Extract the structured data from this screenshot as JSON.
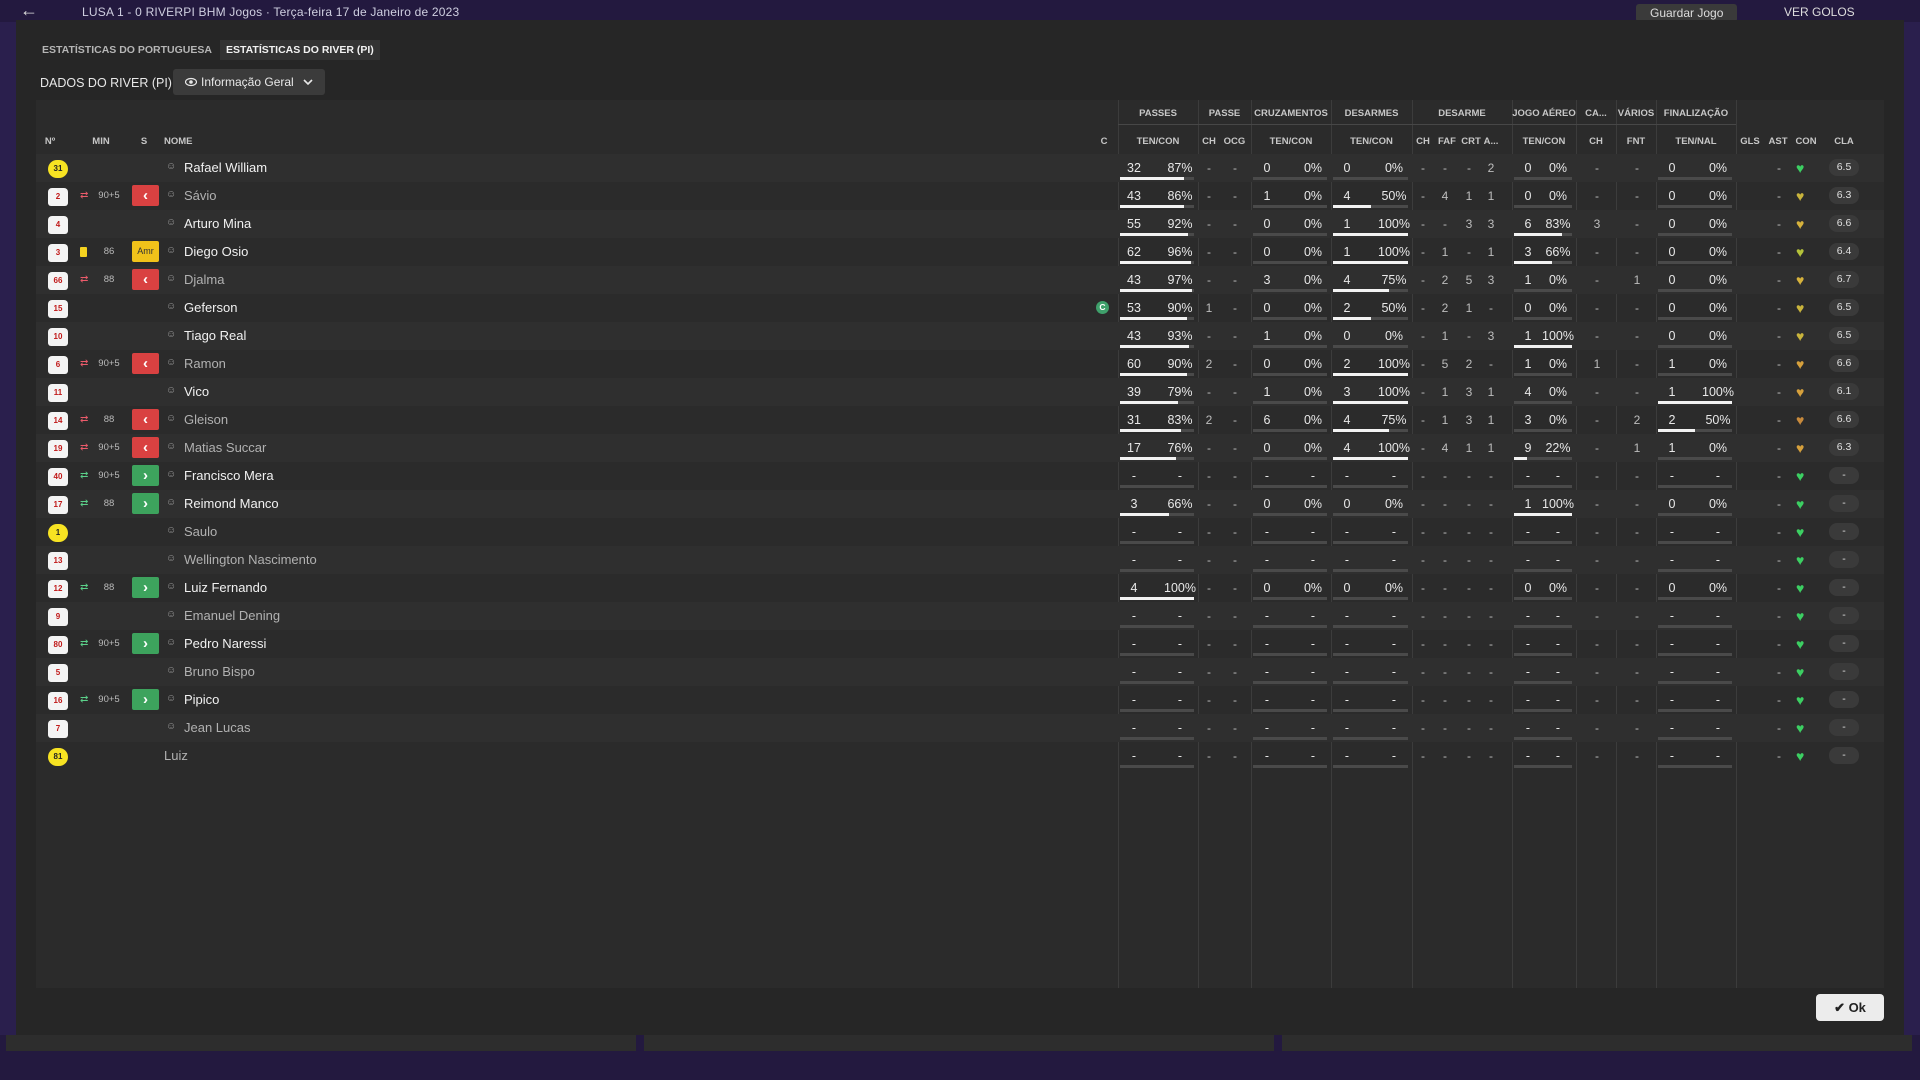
{
  "topbar": {
    "back": "←",
    "match": "LUSA  1 - 0  RIVERPI  BHM  Jogos  ·  Terça-feira 17 de Janeiro de 2023",
    "save": "Guardar Jogo",
    "goals": "VER GOLOS"
  },
  "tabs": [
    {
      "label": "ESTATÍSTICAS DO PORTUGUESA"
    },
    {
      "label": "ESTATÍSTICAS DO RIVER (PI)"
    }
  ],
  "data_header": "DADOS DO RIVER (PI)",
  "dropdown": {
    "label": "Informação Geral"
  },
  "columns": {
    "no": "Nº",
    "min": "MIN",
    "s": "S",
    "nome": "NOME",
    "c": "C",
    "groups": [
      {
        "label": "PASSES"
      },
      {
        "label": "PASSE"
      },
      {
        "label": "CRUZAMENTOS"
      },
      {
        "label": "DESARMES"
      },
      {
        "label": "DESARME"
      },
      {
        "label": "JOGO AÉREO"
      },
      {
        "label": "CA..."
      },
      {
        "label": "VÁRIOS"
      },
      {
        "label": "FINALIZAÇÃO"
      }
    ],
    "subs": [
      {
        "label": "TEN/CON"
      },
      {
        "label": "CH"
      },
      {
        "label": "OCG"
      },
      {
        "label": "TEN/CON"
      },
      {
        "label": "TEN/CON"
      },
      {
        "label": "CH"
      },
      {
        "label": "FAF"
      },
      {
        "label": "CRT"
      },
      {
        "label": "A..."
      },
      {
        "label": "TEN/CON"
      },
      {
        "label": "CH"
      },
      {
        "label": "FNT"
      },
      {
        "label": "TEN/NAL"
      },
      {
        "label": "GLS"
      },
      {
        "label": "AST"
      },
      {
        "label": "CON"
      },
      {
        "label": "CLA"
      }
    ]
  },
  "players": [
    {
      "no": "31",
      "gk": true,
      "sub": "",
      "min": "",
      "s": "",
      "name": "Rafael William",
      "dim": false,
      "person": true,
      "cap": false,
      "pass": [
        "32",
        "87%"
      ],
      "pass_pct": 87,
      "ch": "-",
      "ocg": "-",
      "cross": [
        "0",
        "0%"
      ],
      "cross_pct": 0,
      "tack": [
        "0",
        "0%"
      ],
      "tack_pct": 0,
      "tk": [
        "-",
        "-",
        "-",
        "2"
      ],
      "air": [
        "0",
        "0%"
      ],
      "air_pct": 0,
      "ca": "-",
      "fnt": "-",
      "fin": [
        "0",
        "0%"
      ],
      "fin_pct": 0,
      "gls": "",
      "ast": "-",
      "heart": "#3ccf62",
      "cla": "6.5"
    },
    {
      "no": "2",
      "gk": false,
      "sub": "out",
      "min": "90+5",
      "s": "out",
      "name": "Sávio",
      "dim": true,
      "person": true,
      "cap": false,
      "pass": [
        "43",
        "86%"
      ],
      "pass_pct": 86,
      "ch": "-",
      "ocg": "-",
      "cross": [
        "1",
        "0%"
      ],
      "cross_pct": 0,
      "tack": [
        "4",
        "50%"
      ],
      "tack_pct": 50,
      "tk": [
        "-",
        "4",
        "1",
        "1"
      ],
      "air": [
        "0",
        "0%"
      ],
      "air_pct": 0,
      "ca": "-",
      "fnt": "-",
      "fin": [
        "0",
        "0%"
      ],
      "fin_pct": 0,
      "gls": "",
      "ast": "-",
      "heart": "#c9b43c",
      "cla": "6.3"
    },
    {
      "no": "4",
      "gk": false,
      "sub": "",
      "min": "",
      "s": "",
      "name": "Arturo Mina",
      "dim": false,
      "person": true,
      "cap": false,
      "pass": [
        "55",
        "92%"
      ],
      "pass_pct": 92,
      "ch": "-",
      "ocg": "-",
      "cross": [
        "0",
        "0%"
      ],
      "cross_pct": 0,
      "tack": [
        "1",
        "100%"
      ],
      "tack_pct": 100,
      "tk": [
        "-",
        "-",
        "3",
        "3"
      ],
      "air": [
        "6",
        "83%"
      ],
      "air_pct": 83,
      "ca": "3",
      "fnt": "-",
      "fin": [
        "0",
        "0%"
      ],
      "fin_pct": 0,
      "gls": "",
      "ast": "-",
      "heart": "#d6b23c",
      "cla": "6.6"
    },
    {
      "no": "3",
      "gk": false,
      "sub": "yellow",
      "min": "86",
      "s": "amr",
      "name": "Diego Osio",
      "dim": false,
      "person": true,
      "cap": false,
      "pass": [
        "62",
        "96%"
      ],
      "pass_pct": 96,
      "ch": "-",
      "ocg": "-",
      "cross": [
        "0",
        "0%"
      ],
      "cross_pct": 0,
      "tack": [
        "1",
        "100%"
      ],
      "tack_pct": 100,
      "tk": [
        "-",
        "1",
        "-",
        "1"
      ],
      "air": [
        "3",
        "66%"
      ],
      "air_pct": 66,
      "ca": "-",
      "fnt": "-",
      "fin": [
        "0",
        "0%"
      ],
      "fin_pct": 0,
      "gls": "",
      "ast": "-",
      "heart": "#b4c23a",
      "cla": "6.4"
    },
    {
      "no": "66",
      "gk": false,
      "sub": "out",
      "min": "88",
      "s": "out",
      "name": "Djalma",
      "dim": true,
      "person": true,
      "cap": false,
      "pass": [
        "43",
        "97%"
      ],
      "pass_pct": 97,
      "ch": "-",
      "ocg": "-",
      "cross": [
        "3",
        "0%"
      ],
      "cross_pct": 0,
      "tack": [
        "4",
        "75%"
      ],
      "tack_pct": 75,
      "tk": [
        "-",
        "2",
        "5",
        "3"
      ],
      "air": [
        "1",
        "0%"
      ],
      "air_pct": 0,
      "ca": "-",
      "fnt": "1",
      "fin": [
        "0",
        "0%"
      ],
      "fin_pct": 0,
      "gls": "",
      "ast": "-",
      "heart": "#d6b23c",
      "cla": "6.7"
    },
    {
      "no": "15",
      "gk": false,
      "sub": "",
      "min": "",
      "s": "",
      "name": "Geferson",
      "dim": false,
      "person": true,
      "cap": true,
      "pass": [
        "53",
        "90%"
      ],
      "pass_pct": 90,
      "ch": "1",
      "ocg": "-",
      "cross": [
        "0",
        "0%"
      ],
      "cross_pct": 0,
      "tack": [
        "2",
        "50%"
      ],
      "tack_pct": 50,
      "tk": [
        "-",
        "2",
        "1",
        "-"
      ],
      "air": [
        "0",
        "0%"
      ],
      "air_pct": 0,
      "ca": "-",
      "fnt": "-",
      "fin": [
        "0",
        "0%"
      ],
      "fin_pct": 0,
      "gls": "",
      "ast": "-",
      "heart": "#c9b43c",
      "cla": "6.5"
    },
    {
      "no": "10",
      "gk": false,
      "sub": "",
      "min": "",
      "s": "",
      "name": "Tiago Real",
      "dim": false,
      "person": true,
      "cap": false,
      "pass": [
        "43",
        "93%"
      ],
      "pass_pct": 93,
      "ch": "-",
      "ocg": "-",
      "cross": [
        "1",
        "0%"
      ],
      "cross_pct": 0,
      "tack": [
        "0",
        "0%"
      ],
      "tack_pct": 0,
      "tk": [
        "-",
        "1",
        "-",
        "3"
      ],
      "air": [
        "1",
        "100%"
      ],
      "air_pct": 100,
      "ca": "-",
      "fnt": "-",
      "fin": [
        "0",
        "0%"
      ],
      "fin_pct": 0,
      "gls": "",
      "ast": "-",
      "heart": "#c9b43c",
      "cla": "6.5"
    },
    {
      "no": "6",
      "gk": false,
      "sub": "out",
      "min": "90+5",
      "s": "out",
      "name": "Ramon",
      "dim": true,
      "person": true,
      "cap": false,
      "pass": [
        "60",
        "90%"
      ],
      "pass_pct": 90,
      "ch": "2",
      "ocg": "-",
      "cross": [
        "0",
        "0%"
      ],
      "cross_pct": 0,
      "tack": [
        "2",
        "100%"
      ],
      "tack_pct": 100,
      "tk": [
        "-",
        "5",
        "2",
        "-"
      ],
      "air": [
        "1",
        "0%"
      ],
      "air_pct": 0,
      "ca": "1",
      "fnt": "-",
      "fin": [
        "1",
        "0%"
      ],
      "fin_pct": 0,
      "gls": "",
      "ast": "-",
      "heart": "#d6a03c",
      "cla": "6.6"
    },
    {
      "no": "11",
      "gk": false,
      "sub": "",
      "min": "",
      "s": "",
      "name": "Vico",
      "dim": false,
      "person": true,
      "cap": false,
      "pass": [
        "39",
        "79%"
      ],
      "pass_pct": 79,
      "ch": "-",
      "ocg": "-",
      "cross": [
        "1",
        "0%"
      ],
      "cross_pct": 0,
      "tack": [
        "3",
        "100%"
      ],
      "tack_pct": 100,
      "tk": [
        "-",
        "1",
        "3",
        "1"
      ],
      "air": [
        "4",
        "0%"
      ],
      "air_pct": 0,
      "ca": "-",
      "fnt": "-",
      "fin": [
        "1",
        "100%"
      ],
      "fin_pct": 100,
      "gls": "",
      "ast": "-",
      "heart": "#d6a03c",
      "cla": "6.1"
    },
    {
      "no": "14",
      "gk": false,
      "sub": "out",
      "min": "88",
      "s": "out",
      "name": "Gleison",
      "dim": true,
      "person": true,
      "cap": false,
      "pass": [
        "31",
        "83%"
      ],
      "pass_pct": 83,
      "ch": "2",
      "ocg": "-",
      "cross": [
        "6",
        "0%"
      ],
      "cross_pct": 0,
      "tack": [
        "4",
        "75%"
      ],
      "tack_pct": 75,
      "tk": [
        "-",
        "1",
        "3",
        "1"
      ],
      "air": [
        "3",
        "0%"
      ],
      "air_pct": 0,
      "ca": "-",
      "fnt": "2",
      "fin": [
        "2",
        "50%"
      ],
      "fin_pct": 50,
      "gls": "",
      "ast": "-",
      "heart": "#c88a3c",
      "cla": "6.6"
    },
    {
      "no": "19",
      "gk": false,
      "sub": "out",
      "min": "90+5",
      "s": "out",
      "name": "Matias Succar",
      "dim": true,
      "person": true,
      "cap": false,
      "pass": [
        "17",
        "76%"
      ],
      "pass_pct": 76,
      "ch": "-",
      "ocg": "-",
      "cross": [
        "0",
        "0%"
      ],
      "cross_pct": 0,
      "tack": [
        "4",
        "100%"
      ],
      "tack_pct": 100,
      "tk": [
        "-",
        "4",
        "1",
        "1"
      ],
      "air": [
        "9",
        "22%"
      ],
      "air_pct": 22,
      "ca": "-",
      "fnt": "1",
      "fin": [
        "1",
        "0%"
      ],
      "fin_pct": 0,
      "gls": "",
      "ast": "-",
      "heart": "#d6a03c",
      "cla": "6.3"
    },
    {
      "no": "40",
      "gk": false,
      "sub": "in",
      "min": "90+5",
      "s": "in",
      "name": "Francisco Mera",
      "dim": false,
      "person": true,
      "cap": false,
      "pass": [
        "-",
        "-"
      ],
      "pass_pct": -1,
      "ch": "-",
      "ocg": "-",
      "cross": [
        "-",
        "-"
      ],
      "cross_pct": -1,
      "tack": [
        "-",
        "-"
      ],
      "tack_pct": -1,
      "tk": [
        "-",
        "-",
        "-",
        "-"
      ],
      "air": [
        "-",
        "-"
      ],
      "air_pct": -1,
      "ca": "-",
      "fnt": "-",
      "fin": [
        "-",
        "-"
      ],
      "fin_pct": -1,
      "gls": "",
      "ast": "-",
      "heart": "#3ccf62",
      "cla": "-"
    },
    {
      "no": "17",
      "gk": false,
      "sub": "in",
      "min": "88",
      "s": "in",
      "name": "Reimond Manco",
      "dim": false,
      "person": true,
      "cap": false,
      "pass": [
        "3",
        "66%"
      ],
      "pass_pct": 66,
      "ch": "-",
      "ocg": "-",
      "cross": [
        "0",
        "0%"
      ],
      "cross_pct": 0,
      "tack": [
        "0",
        "0%"
      ],
      "tack_pct": 0,
      "tk": [
        "-",
        "-",
        "-",
        "-"
      ],
      "air": [
        "1",
        "100%"
      ],
      "air_pct": 100,
      "ca": "-",
      "fnt": "-",
      "fin": [
        "0",
        "0%"
      ],
      "fin_pct": 0,
      "gls": "",
      "ast": "-",
      "heart": "#3ccf62",
      "cla": "-"
    },
    {
      "no": "1",
      "gk": true,
      "sub": "",
      "min": "",
      "s": "",
      "name": "Saulo",
      "dim": true,
      "person": true,
      "cap": false,
      "pass": [
        "-",
        "-"
      ],
      "pass_pct": -1,
      "ch": "-",
      "ocg": "-",
      "cross": [
        "-",
        "-"
      ],
      "cross_pct": -1,
      "tack": [
        "-",
        "-"
      ],
      "tack_pct": -1,
      "tk": [
        "-",
        "-",
        "-",
        "-"
      ],
      "air": [
        "-",
        "-"
      ],
      "air_pct": -1,
      "ca": "-",
      "fnt": "-",
      "fin": [
        "-",
        "-"
      ],
      "fin_pct": -1,
      "gls": "",
      "ast": "-",
      "heart": "#3ccf62",
      "cla": "-"
    },
    {
      "no": "13",
      "gk": false,
      "sub": "",
      "min": "",
      "s": "",
      "name": "Wellington Nascimento",
      "dim": true,
      "person": true,
      "cap": false,
      "pass": [
        "-",
        "-"
      ],
      "pass_pct": -1,
      "ch": "-",
      "ocg": "-",
      "cross": [
        "-",
        "-"
      ],
      "cross_pct": -1,
      "tack": [
        "-",
        "-"
      ],
      "tack_pct": -1,
      "tk": [
        "-",
        "-",
        "-",
        "-"
      ],
      "air": [
        "-",
        "-"
      ],
      "air_pct": -1,
      "ca": "-",
      "fnt": "-",
      "fin": [
        "-",
        "-"
      ],
      "fin_pct": -1,
      "gls": "",
      "ast": "-",
      "heart": "#3ccf62",
      "cla": "-"
    },
    {
      "no": "12",
      "gk": false,
      "sub": "in",
      "min": "88",
      "s": "in",
      "name": "Luiz Fernando",
      "dim": false,
      "person": true,
      "cap": false,
      "pass": [
        "4",
        "100%"
      ],
      "pass_pct": 100,
      "ch": "-",
      "ocg": "-",
      "cross": [
        "0",
        "0%"
      ],
      "cross_pct": 0,
      "tack": [
        "0",
        "0%"
      ],
      "tack_pct": 0,
      "tk": [
        "-",
        "-",
        "-",
        "-"
      ],
      "air": [
        "0",
        "0%"
      ],
      "air_pct": 0,
      "ca": "-",
      "fnt": "-",
      "fin": [
        "0",
        "0%"
      ],
      "fin_pct": 0,
      "gls": "",
      "ast": "-",
      "heart": "#3ccf62",
      "cla": "-"
    },
    {
      "no": "9",
      "gk": false,
      "sub": "",
      "min": "",
      "s": "",
      "name": "Emanuel Dening",
      "dim": true,
      "person": true,
      "cap": false,
      "pass": [
        "-",
        "-"
      ],
      "pass_pct": -1,
      "ch": "-",
      "ocg": "-",
      "cross": [
        "-",
        "-"
      ],
      "cross_pct": -1,
      "tack": [
        "-",
        "-"
      ],
      "tack_pct": -1,
      "tk": [
        "-",
        "-",
        "-",
        "-"
      ],
      "air": [
        "-",
        "-"
      ],
      "air_pct": -1,
      "ca": "-",
      "fnt": "-",
      "fin": [
        "-",
        "-"
      ],
      "fin_pct": -1,
      "gls": "",
      "ast": "-",
      "heart": "#3ccf62",
      "cla": "-"
    },
    {
      "no": "80",
      "gk": false,
      "sub": "in",
      "min": "90+5",
      "s": "in",
      "name": "Pedro Naressi",
      "dim": false,
      "person": true,
      "cap": false,
      "pass": [
        "-",
        "-"
      ],
      "pass_pct": -1,
      "ch": "-",
      "ocg": "-",
      "cross": [
        "-",
        "-"
      ],
      "cross_pct": -1,
      "tack": [
        "-",
        "-"
      ],
      "tack_pct": -1,
      "tk": [
        "-",
        "-",
        "-",
        "-"
      ],
      "air": [
        "-",
        "-"
      ],
      "air_pct": -1,
      "ca": "-",
      "fnt": "-",
      "fin": [
        "-",
        "-"
      ],
      "fin_pct": -1,
      "gls": "",
      "ast": "-",
      "heart": "#3ccf62",
      "cla": "-"
    },
    {
      "no": "5",
      "gk": false,
      "sub": "",
      "min": "",
      "s": "",
      "name": "Bruno Bispo",
      "dim": true,
      "person": true,
      "cap": false,
      "pass": [
        "-",
        "-"
      ],
      "pass_pct": -1,
      "ch": "-",
      "ocg": "-",
      "cross": [
        "-",
        "-"
      ],
      "cross_pct": -1,
      "tack": [
        "-",
        "-"
      ],
      "tack_pct": -1,
      "tk": [
        "-",
        "-",
        "-",
        "-"
      ],
      "air": [
        "-",
        "-"
      ],
      "air_pct": -1,
      "ca": "-",
      "fnt": "-",
      "fin": [
        "-",
        "-"
      ],
      "fin_pct": -1,
      "gls": "",
      "ast": "-",
      "heart": "#3ccf62",
      "cla": "-"
    },
    {
      "no": "16",
      "gk": false,
      "sub": "in",
      "min": "90+5",
      "s": "in",
      "name": "Pipico",
      "dim": false,
      "person": true,
      "cap": false,
      "pass": [
        "-",
        "-"
      ],
      "pass_pct": -1,
      "ch": "-",
      "ocg": "-",
      "cross": [
        "-",
        "-"
      ],
      "cross_pct": -1,
      "tack": [
        "-",
        "-"
      ],
      "tack_pct": -1,
      "tk": [
        "-",
        "-",
        "-",
        "-"
      ],
      "air": [
        "-",
        "-"
      ],
      "air_pct": -1,
      "ca": "-",
      "fnt": "-",
      "fin": [
        "-",
        "-"
      ],
      "fin_pct": -1,
      "gls": "",
      "ast": "-",
      "heart": "#3ccf62",
      "cla": "-"
    },
    {
      "no": "7",
      "gk": false,
      "sub": "",
      "min": "",
      "s": "",
      "name": "Jean Lucas",
      "dim": true,
      "person": true,
      "cap": false,
      "pass": [
        "-",
        "-"
      ],
      "pass_pct": -1,
      "ch": "-",
      "ocg": "-",
      "cross": [
        "-",
        "-"
      ],
      "cross_pct": -1,
      "tack": [
        "-",
        "-"
      ],
      "tack_pct": -1,
      "tk": [
        "-",
        "-",
        "-",
        "-"
      ],
      "air": [
        "-",
        "-"
      ],
      "air_pct": -1,
      "ca": "-",
      "fnt": "-",
      "fin": [
        "-",
        "-"
      ],
      "fin_pct": -1,
      "gls": "",
      "ast": "-",
      "heart": "#3ccf62",
      "cla": "-"
    },
    {
      "no": "81",
      "gk": true,
      "sub": "",
      "min": "",
      "s": "",
      "name": "Luiz",
      "dim": true,
      "person": false,
      "cap": false,
      "pass": [
        "-",
        "-"
      ],
      "pass_pct": -1,
      "ch": "-",
      "ocg": "-",
      "cross": [
        "-",
        "-"
      ],
      "cross_pct": -1,
      "tack": [
        "-",
        "-"
      ],
      "tack_pct": -1,
      "tk": [
        "-",
        "-",
        "-",
        "-"
      ],
      "air": [
        "-",
        "-"
      ],
      "air_pct": -1,
      "ca": "-",
      "fnt": "-",
      "fin": [
        "-",
        "-"
      ],
      "fin_pct": -1,
      "gls": "",
      "ast": "-",
      "heart": "#3ccf62",
      "cla": "-"
    }
  ],
  "cap_letter": "C",
  "ok_button": "✔ Ok",
  "icons": {
    "eye": "eye-icon",
    "chevron": "chevron-down-icon",
    "person": "person-icon",
    "heart": "heart-icon",
    "sub_out": "sub-out-icon",
    "sub_in": "sub-in-icon",
    "save": "save-icon",
    "play": "play-icon"
  }
}
